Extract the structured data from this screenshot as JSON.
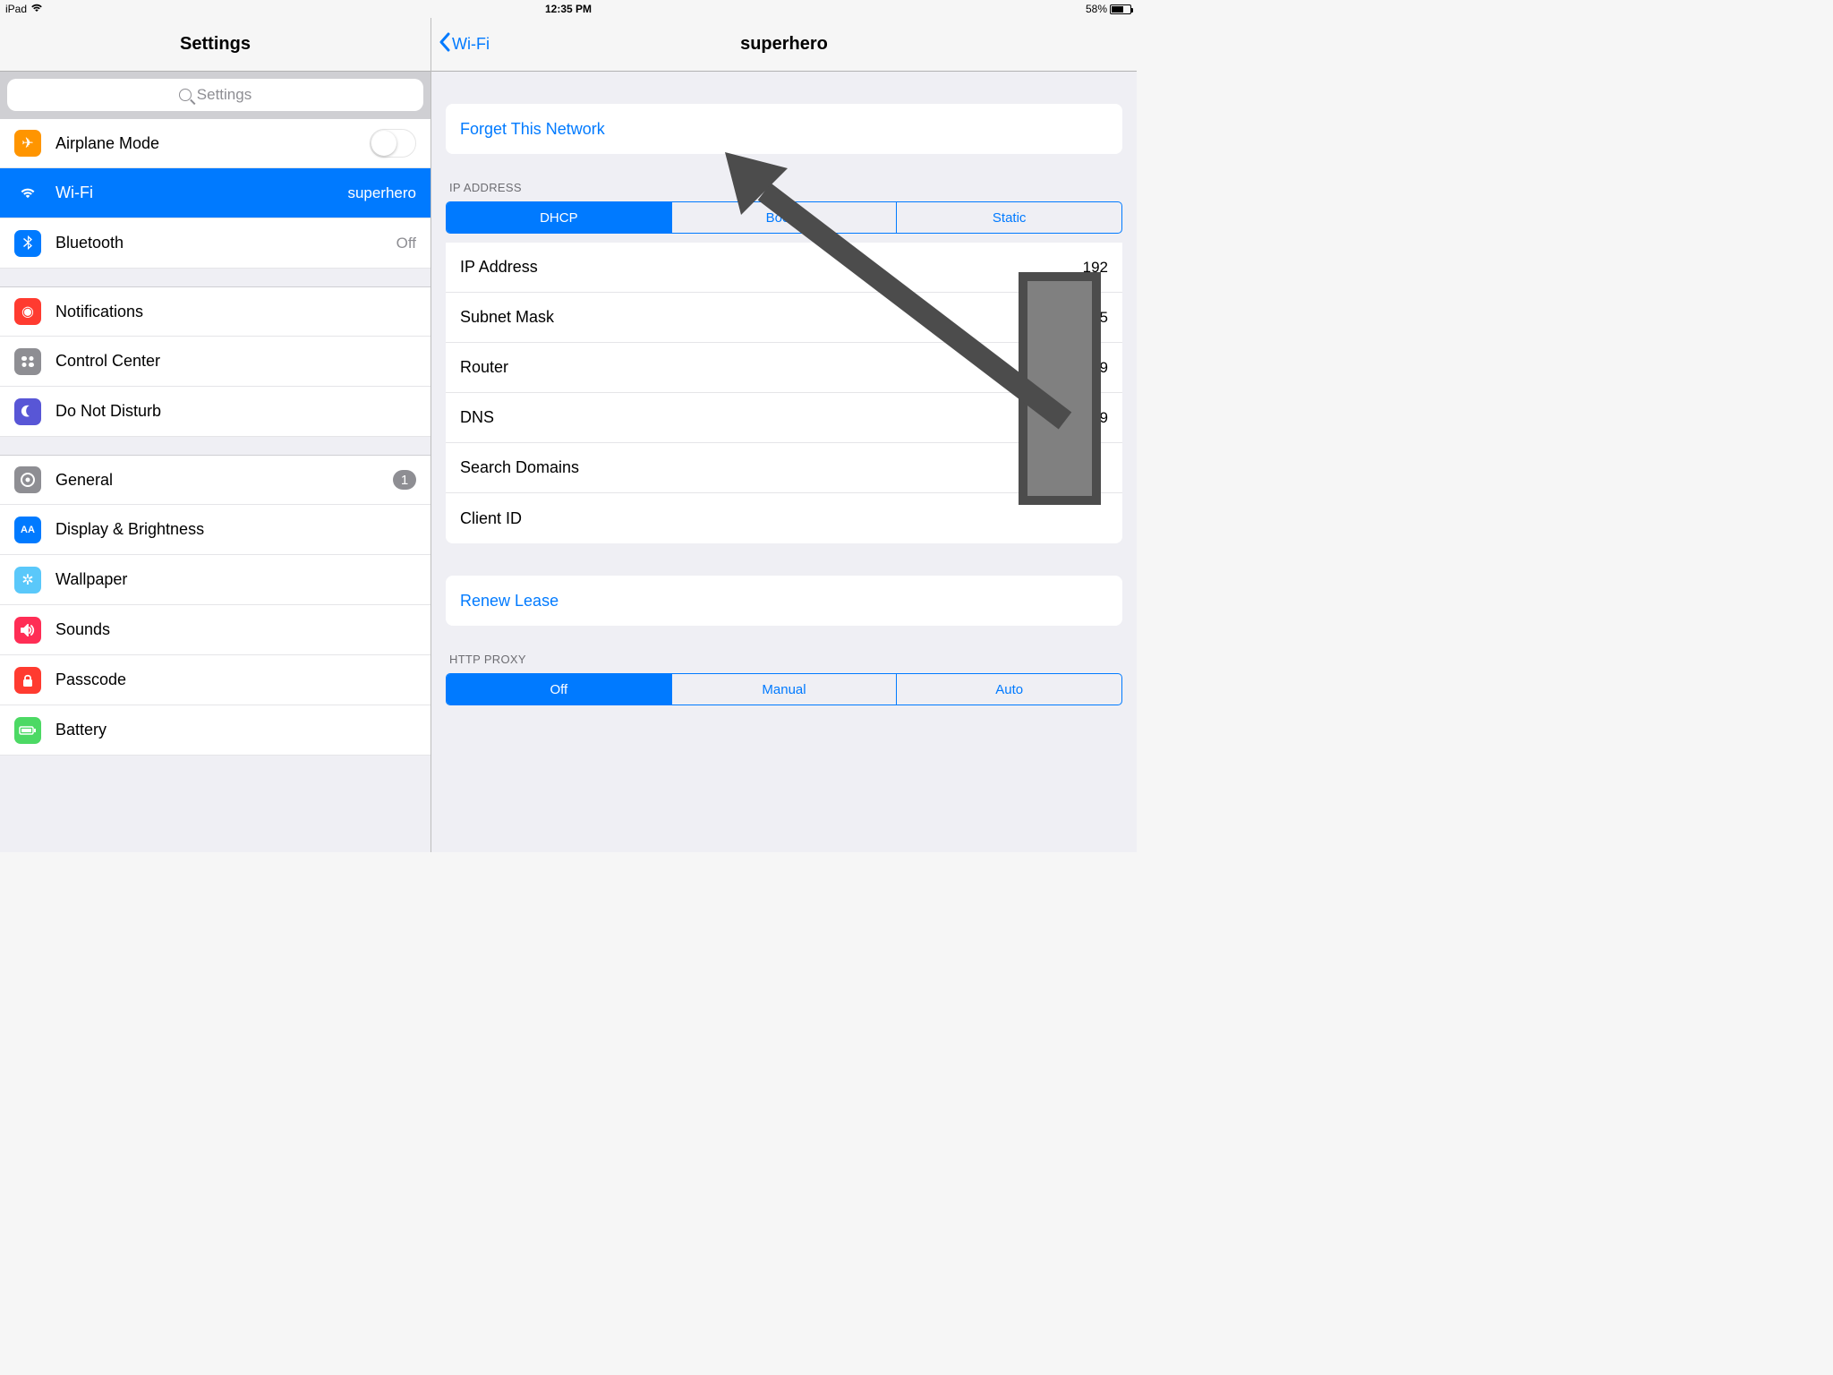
{
  "status": {
    "device": "iPad",
    "time": "12:35 PM",
    "battery_pct": "58%"
  },
  "sidebar": {
    "title": "Settings",
    "search_placeholder": "Settings",
    "airplane": "Airplane Mode",
    "wifi_label": "Wi-Fi",
    "wifi_value": "superhero",
    "bluetooth_label": "Bluetooth",
    "bluetooth_value": "Off",
    "notifications": "Notifications",
    "control_center": "Control Center",
    "dnd": "Do Not Disturb",
    "general": "General",
    "general_badge": "1",
    "display": "Display & Brightness",
    "wallpaper": "Wallpaper",
    "sounds": "Sounds",
    "passcode": "Passcode",
    "battery": "Battery"
  },
  "detail": {
    "back": "Wi-Fi",
    "title": "superhero",
    "forget": "Forget This Network",
    "ip_header": "IP ADDRESS",
    "seg_dhcp": "DHCP",
    "seg_bootp": "BootP",
    "seg_static": "Static",
    "rows": {
      "ip_label": "IP Address",
      "ip_value": "192",
      "subnet_label": "Subnet Mask",
      "subnet_value": "255.25",
      "router_label": "Router",
      "router_value": "19",
      "dns_label": "DNS",
      "dns_value": "19",
      "search_label": "Search Domains",
      "client_label": "Client ID"
    },
    "renew": "Renew Lease",
    "proxy_header": "HTTP PROXY",
    "seg_off": "Off",
    "seg_manual": "Manual",
    "seg_auto": "Auto"
  }
}
